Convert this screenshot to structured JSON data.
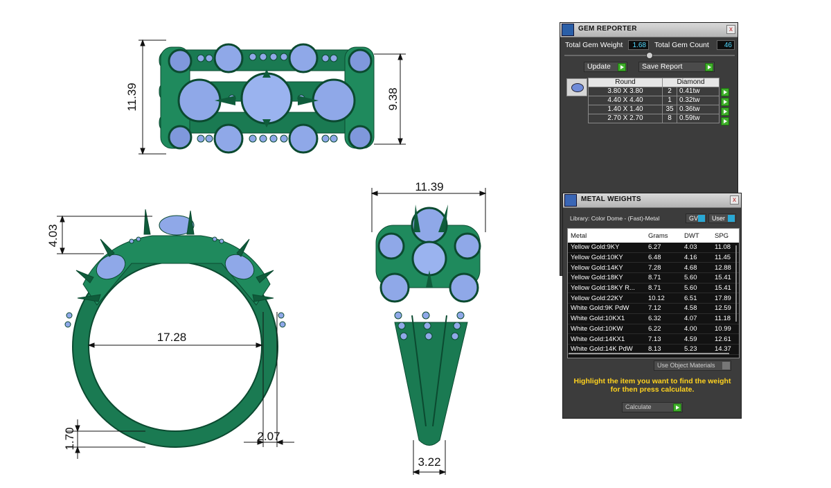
{
  "drawing": {
    "dimensions": {
      "top_height": "11.39",
      "top_inner": "9.38",
      "front_shoulder": "4.03",
      "front_inner": "17.28",
      "front_shank": "1.70",
      "front_band": "2.07",
      "side_width": "11.39",
      "side_bottom": "3.22"
    },
    "colors": {
      "metal": "#1a7a52",
      "metal_dark": "#0f5c3b",
      "gem": "#8fa8e8",
      "gem_dark": "#5d77c4"
    }
  },
  "gem_reporter": {
    "title": "GEM REPORTER",
    "close": "x",
    "total_weight_label": "Total Gem Weight",
    "total_weight_value": "1.68",
    "total_count_label": "Total Gem Count",
    "total_count_value": "46",
    "update_label": "Update",
    "save_report_label": "Save Report",
    "table": {
      "col_shape": "Round",
      "col_material": "Diamond",
      "rows": [
        {
          "size": "3.80 X 3.80",
          "count": "2",
          "weight": "0.41tw"
        },
        {
          "size": "4.40 X 4.40",
          "count": "1",
          "weight": "0.32tw"
        },
        {
          "size": "1.40 X 1.40",
          "count": "35",
          "weight": "0.36tw"
        },
        {
          "size": "2.70 X 2.70",
          "count": "8",
          "weight": "0.59tw"
        }
      ]
    }
  },
  "metal_weights": {
    "title": "METAL WEIGHTS",
    "close": "x",
    "library": "Library: Color Dome - (Fast)-Metal",
    "gv_label": "GV",
    "user_label": "User",
    "columns": [
      "Metal",
      "Grams",
      "DWT",
      "SPG"
    ],
    "rows": [
      [
        "Yellow Gold:9KY",
        "6.27",
        "4.03",
        "11.08"
      ],
      [
        "Yellow Gold:10KY",
        "6.48",
        "4.16",
        "11.45"
      ],
      [
        "Yellow Gold:14KY",
        "7.28",
        "4.68",
        "12.88"
      ],
      [
        "Yellow Gold:18KY",
        "8.71",
        "5.60",
        "15.41"
      ],
      [
        "Yellow Gold:18KY R...",
        "8.71",
        "5.60",
        "15.41"
      ],
      [
        "Yellow Gold:22KY",
        "10.12",
        "6.51",
        "17.89"
      ],
      [
        "White Gold:9K PdW",
        "7.12",
        "4.58",
        "12.59"
      ],
      [
        "White Gold:10KX1",
        "6.32",
        "4.07",
        "11.18"
      ],
      [
        "White Gold:10KW",
        "6.22",
        "4.00",
        "10.99"
      ],
      [
        "White Gold:14KX1",
        "7.13",
        "4.59",
        "12.61"
      ],
      [
        "White Gold:14K PdW",
        "8.13",
        "5.23",
        "14.37"
      ]
    ],
    "use_object_materials": "Use Object Materials",
    "instruction": "Highlight the item you want to find the weight for then press calculate.",
    "calculate_label": "Calculate"
  }
}
